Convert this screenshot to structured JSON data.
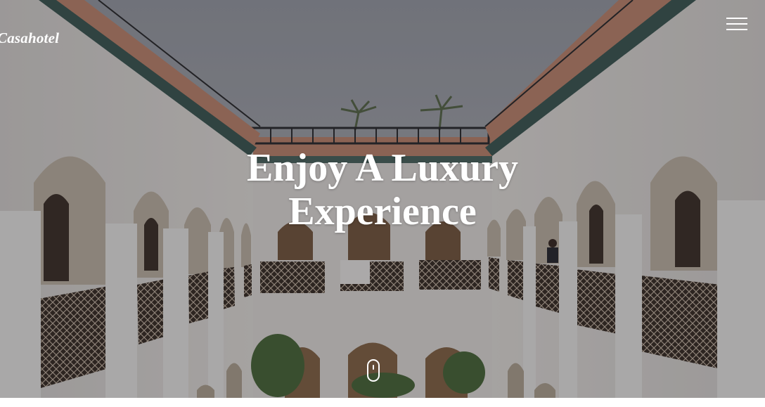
{
  "header": {
    "brand": "Casahotel",
    "menu_icon": "hamburger-menu-icon"
  },
  "hero": {
    "headline_line1": "Enjoy A Luxury",
    "headline_line2": "Experience",
    "scroll_icon": "mouse-scroll-icon",
    "image_subject": "riad-courtyard-photo"
  },
  "colors": {
    "overlay": "#141419",
    "text": "#ffffff",
    "wall": "#ece8e4",
    "terracotta": "#b9806a",
    "tile": "#3d5a55"
  }
}
